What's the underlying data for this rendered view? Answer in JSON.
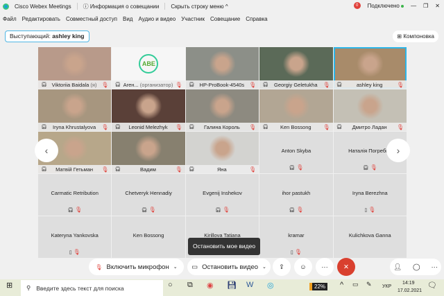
{
  "title": {
    "app": "Cisco Webex Meetings",
    "info": "Информация о совещании",
    "hide_menu": "Скрыть строку меню ^",
    "badge": "0",
    "status": "Подключено"
  },
  "menu": [
    "Файл",
    "Редактировать",
    "Совместный доступ",
    "Вид",
    "Аудио и видео",
    "Участник",
    "Совещание",
    "Справка"
  ],
  "speaker": {
    "label": "Выступающий:",
    "name": "ashley king"
  },
  "layout_label": "Компоновка",
  "video_tiles": [
    {
      "name": "Viktoriia Baidala",
      "suffix": "(я)",
      "bg": "#b89a8a"
    },
    {
      "name": "Аген...",
      "suffix": "(организатор)",
      "bg": "#f6f6f6",
      "logo": "ABE"
    },
    {
      "name": "HP-ProBook-4540s",
      "bg": "#8c8f88"
    },
    {
      "name": "Georgiy Geletukha",
      "bg": "#5b6a58"
    },
    {
      "name": "ashley king",
      "bg": "#a88b6a",
      "selected": true
    },
    {
      "name": "Iryna Khrustalyova",
      "bg": "#a7967f"
    },
    {
      "name": "Leonid Melezhyk",
      "bg": "#5a4038"
    },
    {
      "name": "Галина Король",
      "bg": "#8d8a80"
    },
    {
      "name": "Ken Bossong",
      "bg": "#b2a694"
    },
    {
      "name": "Дмитро Ладан",
      "bg": "#c4c0b5"
    },
    {
      "name": "Матвій Гетьман",
      "bg": "#b7a78a"
    },
    {
      "name": "Вадим",
      "bg": "#87806f"
    },
    {
      "name": "Яна",
      "bg": "#d3d3d0"
    }
  ],
  "audio_tiles": [
    {
      "name": "Anton Skyba",
      "icon": "headset"
    },
    {
      "name": "Наталія Погребна",
      "icon": "headset"
    },
    {
      "name": "Carmatic Retribution",
      "icon": "headset"
    },
    {
      "name": "Chetveryk Hennadiy",
      "icon": "headset"
    },
    {
      "name": "Evgenij Inshekov",
      "icon": "headset"
    },
    {
      "name": "ihor pastukh",
      "icon": "headset"
    },
    {
      "name": "Iryna Berezhna",
      "icon": "phone"
    },
    {
      "name": "Kateryna Yankovska",
      "icon": "phone"
    },
    {
      "name": "Ken Bossong",
      "icon": "none"
    },
    {
      "name": "Kirillova Tatiana",
      "icon": "none"
    },
    {
      "name": "kramar",
      "icon": "phone"
    },
    {
      "name": "Kulichkova Ganna",
      "icon": "none"
    }
  ],
  "tooltip": "Остановить мое видео",
  "controls": {
    "mic": "Включить микрофон",
    "video": "Остановить видео"
  },
  "taskbar": {
    "search_placeholder": "Введите здесь текст для поиска",
    "battery": "22%",
    "lang": "УКР",
    "time": "14:19",
    "date": "17.02.2021",
    "notif": "1"
  }
}
